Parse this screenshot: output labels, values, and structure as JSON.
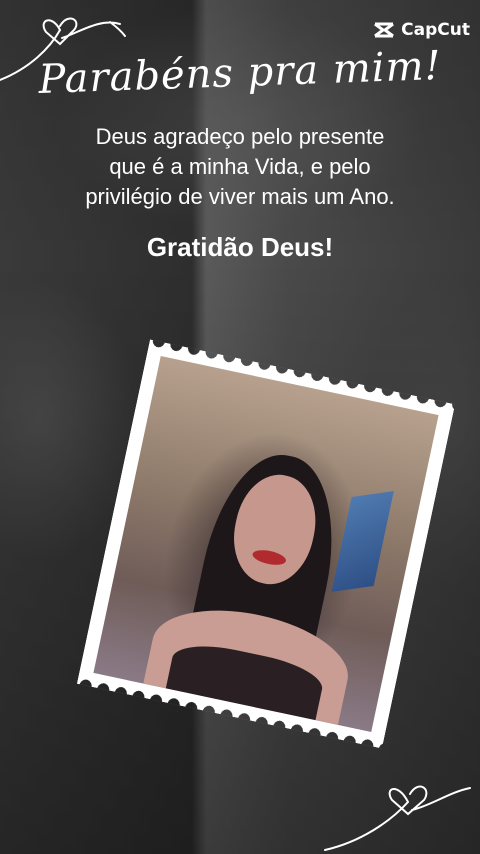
{
  "brand": {
    "name": "CapCut"
  },
  "card": {
    "title": "Parabéns pra mim!",
    "message_lines": [
      "Deus agradeço pelo presente",
      "que é a minha Vida, e pelo",
      "privilégio de viver mais um Ano."
    ],
    "gratitude": "Gratidão Deus!"
  },
  "colors": {
    "text": "#ffffff",
    "background": "#2a2a2a",
    "stamp": "#ffffff"
  },
  "icons": [
    "heart-doodle-icon",
    "capcut-logo-icon"
  ]
}
